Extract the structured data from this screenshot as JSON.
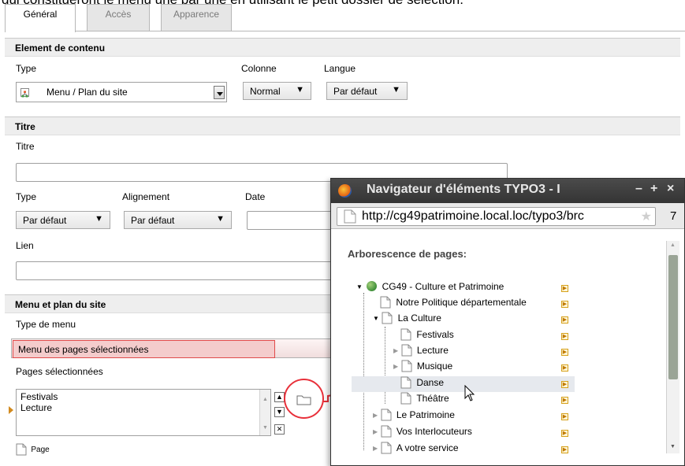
{
  "caption_partial": "qui constitueront le menu une par une en utilisant le petit dossier de sélection.",
  "tabs": [
    {
      "label": "Général"
    },
    {
      "label": "Accès"
    },
    {
      "label": "Apparence"
    }
  ],
  "section_content": {
    "heading": "Element de contenu",
    "type_label": "Type",
    "type_value": "Menu / Plan du site",
    "colonne_label": "Colonne",
    "colonne_value": "Normal",
    "langue_label": "Langue",
    "langue_value": "Par défaut"
  },
  "section_titre": {
    "heading": "Titre",
    "titre_label": "Titre",
    "titre_value": "",
    "type_label": "Type",
    "type_value": "Par défaut",
    "alignement_label": "Alignement",
    "alignement_value": "Par défaut",
    "date_label": "Date",
    "lien_label": "Lien"
  },
  "section_menu": {
    "heading": "Menu et plan du site",
    "menu_type_label": "Type de menu",
    "menu_type_value": "Menu des pages sélectionnées",
    "pages_label": "Pages sélectionnées",
    "pages": [
      "Festivals",
      "Lecture"
    ],
    "page_link_label": "Page"
  },
  "popup": {
    "title": "Navigateur d'éléments TYPO3 - I",
    "url": "http://cg49patrimoine.local.loc/typo3/brc",
    "url_extra": "7",
    "tree_heading": "Arborescence de pages:",
    "tree": [
      {
        "label": "CG49 - Culture et Patrimoine"
      },
      {
        "label": "Notre Politique départementale"
      },
      {
        "label": "La Culture"
      },
      {
        "label": "Festivals"
      },
      {
        "label": "Lecture"
      },
      {
        "label": "Musique"
      },
      {
        "label": "Danse"
      },
      {
        "label": "Théâtre"
      },
      {
        "label": "Le Patrimoine"
      },
      {
        "label": "Vos Interlocuteurs"
      },
      {
        "label": "A votre service"
      }
    ],
    "controls": {
      "minimize": "–",
      "maximize": "+",
      "close": "×"
    }
  },
  "colors": {
    "highlight_red": "#e04a4a",
    "menu_field_bg": "#f4cccc",
    "titlebar": "#3c3c3c",
    "arrow_red": "#e8303a"
  }
}
